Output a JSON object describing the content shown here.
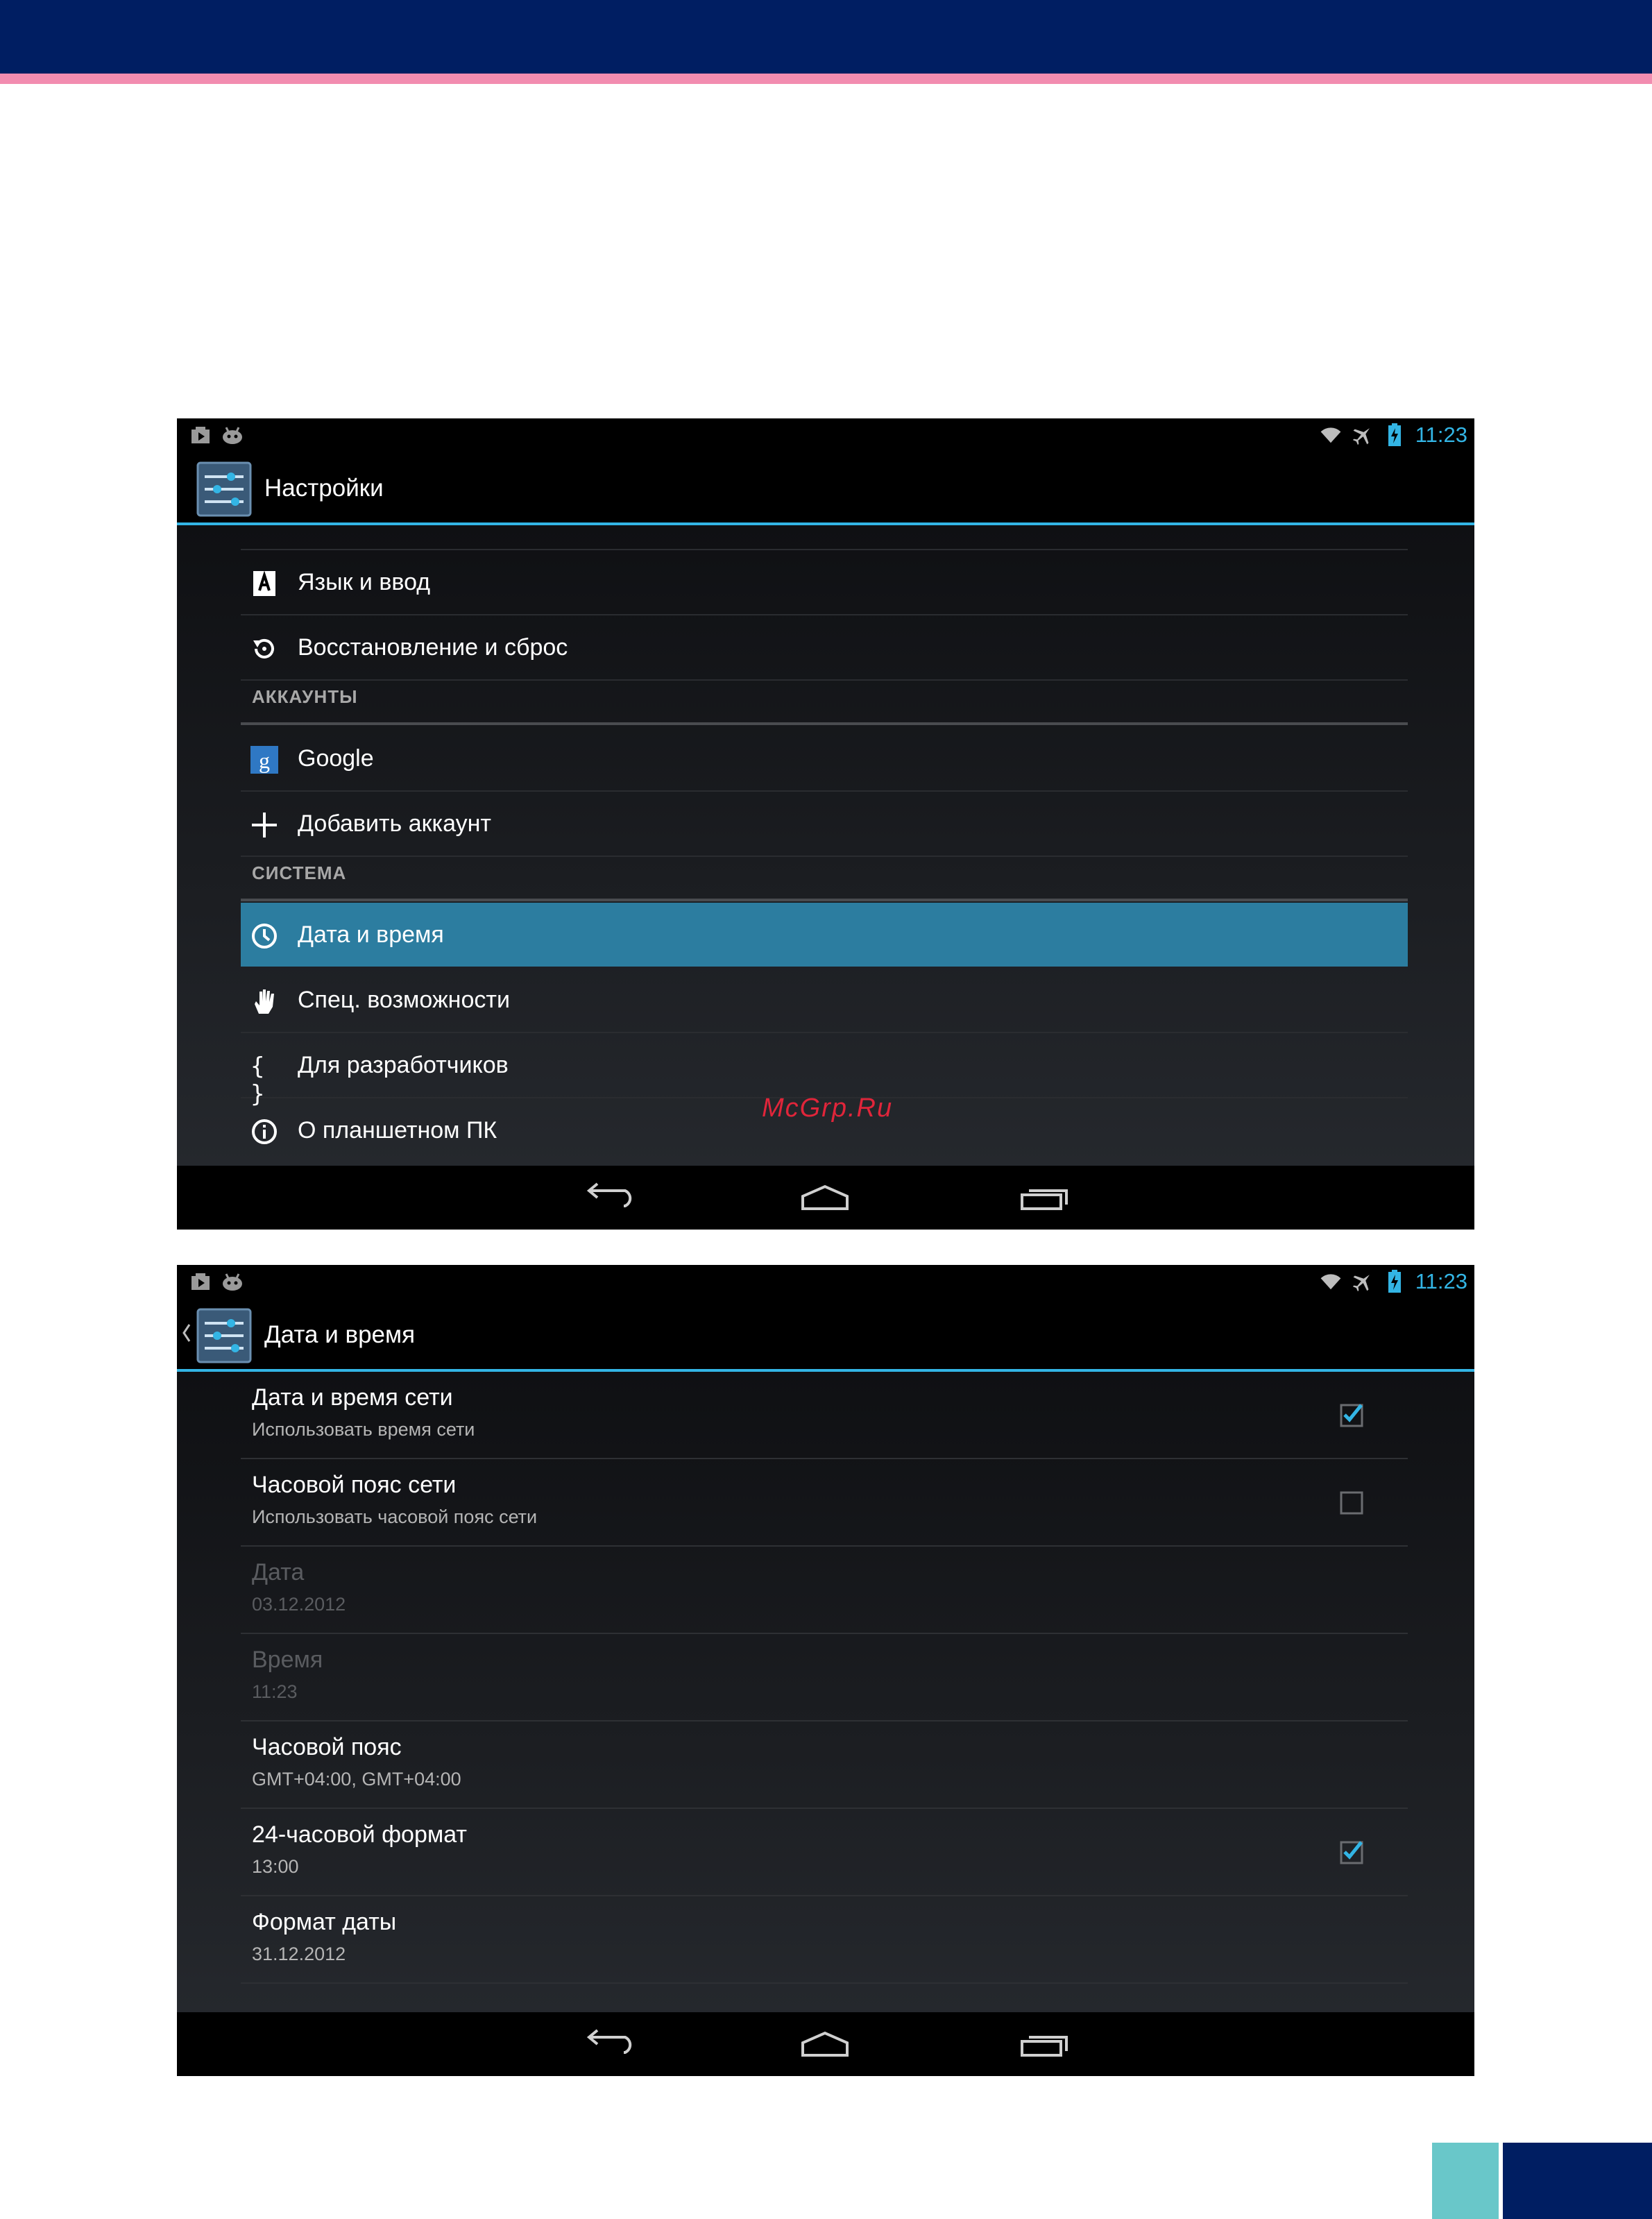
{
  "colors": {
    "page_band": "#001e62",
    "page_stripe": "#f28cb0",
    "corner_teal": "#69c7c9",
    "holo_blue": "#33b5e5",
    "selected_row": "#2c7da0"
  },
  "watermark": "McGrp.Ru",
  "screen1": {
    "status": {
      "time": "11:23",
      "left_icons": [
        "media-notification-icon",
        "android-notification-icon"
      ],
      "right_icons": [
        "wifi-icon",
        "airplane-mode-icon",
        "battery-charging-icon"
      ]
    },
    "title": "Настройки",
    "items": [
      {
        "label": "Язык и ввод",
        "icon": "language-icon"
      },
      {
        "label": "Восстановление и сброс",
        "icon": "restore-icon"
      }
    ],
    "section_accounts": "АККАУНТЫ",
    "accounts": [
      {
        "label": "Google",
        "icon": "google-icon"
      },
      {
        "label": "Добавить аккаунт",
        "icon": "plus-icon"
      }
    ],
    "section_system": "СИСТЕМА",
    "system": [
      {
        "label": "Дата и время",
        "icon": "clock-icon",
        "selected": true
      },
      {
        "label": "Спец. возможности",
        "icon": "hand-icon"
      },
      {
        "label": "Для разработчиков",
        "icon": "braces-icon",
        "glyph": "{ }"
      },
      {
        "label": "О планшетном ПК",
        "icon": "info-icon"
      }
    ],
    "nav": [
      "back-icon",
      "home-icon",
      "recents-icon"
    ]
  },
  "screen2": {
    "status": {
      "time": "11:23"
    },
    "title": "Дата и время",
    "prefs": [
      {
        "title": "Дата и время сети",
        "sub": "Использовать время сети",
        "checked": true
      },
      {
        "title": "Часовой пояс сети",
        "sub": "Использовать часовой пояс сети",
        "checked": false
      },
      {
        "title": "Дата",
        "sub": "03.12.2012",
        "disabled": true
      },
      {
        "title": "Время",
        "sub": "11:23",
        "disabled": true
      },
      {
        "title": "Часовой пояс",
        "sub": "GMT+04:00, GMT+04:00"
      },
      {
        "title": "24-часовой формат",
        "sub": "13:00",
        "checked": true
      },
      {
        "title": "Формат даты",
        "sub": "31.12.2012"
      }
    ]
  }
}
